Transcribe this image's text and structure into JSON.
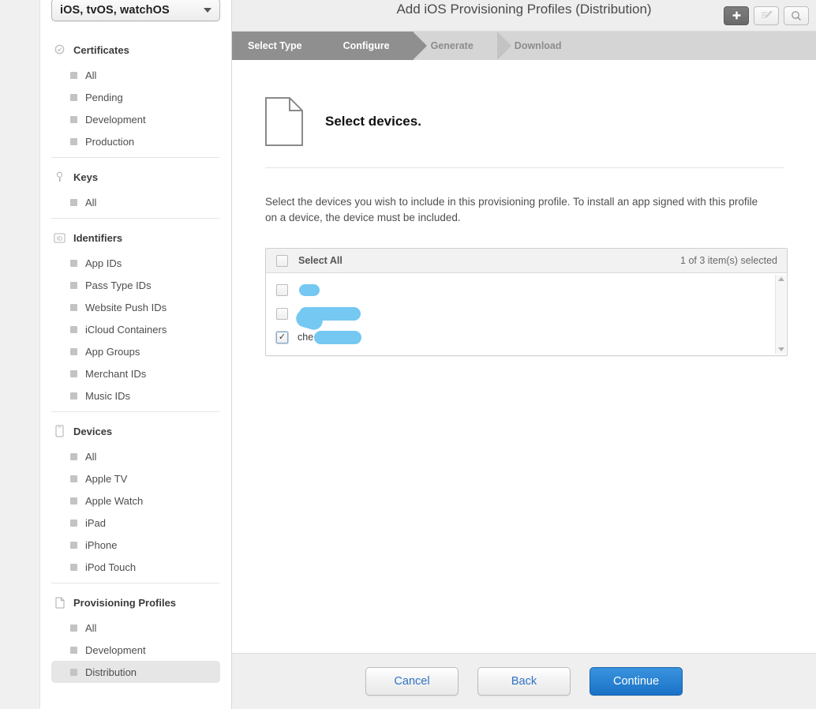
{
  "sidebar": {
    "os_select": {
      "value": "iOS, tvOS, watchOS",
      "caret_icon": "chevron-down-icon"
    },
    "groups": [
      {
        "title": "Certificates",
        "icon": "certificate-seal-icon",
        "items": [
          {
            "label": "All",
            "selected": false
          },
          {
            "label": "Pending",
            "selected": false
          },
          {
            "label": "Development",
            "selected": false
          },
          {
            "label": "Production",
            "selected": false
          }
        ]
      },
      {
        "title": "Keys",
        "icon": "key-icon",
        "items": [
          {
            "label": "All",
            "selected": false
          }
        ]
      },
      {
        "title": "Identifiers",
        "icon": "id-badge-icon",
        "items": [
          {
            "label": "App IDs",
            "selected": false
          },
          {
            "label": "Pass Type IDs",
            "selected": false
          },
          {
            "label": "Website Push IDs",
            "selected": false
          },
          {
            "label": "iCloud Containers",
            "selected": false
          },
          {
            "label": "App Groups",
            "selected": false
          },
          {
            "label": "Merchant IDs",
            "selected": false
          },
          {
            "label": "Music IDs",
            "selected": false
          }
        ]
      },
      {
        "title": "Devices",
        "icon": "phone-icon",
        "items": [
          {
            "label": "All",
            "selected": false
          },
          {
            "label": "Apple TV",
            "selected": false
          },
          {
            "label": "Apple Watch",
            "selected": false
          },
          {
            "label": "iPad",
            "selected": false
          },
          {
            "label": "iPhone",
            "selected": false
          },
          {
            "label": "iPod Touch",
            "selected": false
          }
        ]
      },
      {
        "title": "Provisioning Profiles",
        "icon": "document-icon",
        "items": [
          {
            "label": "All",
            "selected": false
          },
          {
            "label": "Development",
            "selected": false
          },
          {
            "label": "Distribution",
            "selected": true
          }
        ]
      }
    ]
  },
  "topbar": {
    "title": "Add iOS Provisioning Profiles (Distribution)",
    "actions": [
      {
        "name": "add-button",
        "icon": "plus-icon",
        "glyph": "+",
        "state": "primary"
      },
      {
        "name": "edit-button",
        "icon": "edit-pencil-icon",
        "glyph": "✎",
        "state": "disabled"
      },
      {
        "name": "search-button",
        "icon": "search-icon",
        "glyph": "⌕",
        "state": "normal"
      }
    ]
  },
  "steps": [
    {
      "label": "Select Type",
      "state": "done"
    },
    {
      "label": "Configure",
      "state": "current"
    },
    {
      "label": "Generate",
      "state": "todo"
    },
    {
      "label": "Download",
      "state": "todo"
    }
  ],
  "content": {
    "icon": "document-icon",
    "heading": "Select devices.",
    "description": "Select the devices you wish to include in this provisioning profile. To install an app signed with this profile on a device, the device must be included.",
    "device_list": {
      "select_all_label": "Select All",
      "selection_count": "1  of 3 item(s) selected",
      "select_all_checked": false,
      "rows": [
        {
          "name_text": "",
          "redacted": true,
          "redaction_style": "blob-1",
          "checked": false
        },
        {
          "name_text": "",
          "redacted": true,
          "redaction_style": "blob-2",
          "checked": false
        },
        {
          "name_text": "che",
          "redacted": true,
          "redaction_style": "blob-3",
          "checked": true
        }
      ],
      "scrollbar": {
        "up_icon": "scroll-up-arrow-icon",
        "down_icon": "scroll-down-arrow-icon"
      }
    }
  },
  "footer": {
    "buttons": [
      {
        "label": "Cancel",
        "style": "secondary"
      },
      {
        "label": "Back",
        "style": "secondary"
      },
      {
        "label": "Continue",
        "style": "primary"
      }
    ]
  },
  "colors": {
    "accent_blue": "#1a72c7",
    "link_blue": "#2e73c6",
    "redaction_blue": "#74c8f2",
    "step_active": "#8f8f8f",
    "step_inactive": "#d5d5d5"
  }
}
